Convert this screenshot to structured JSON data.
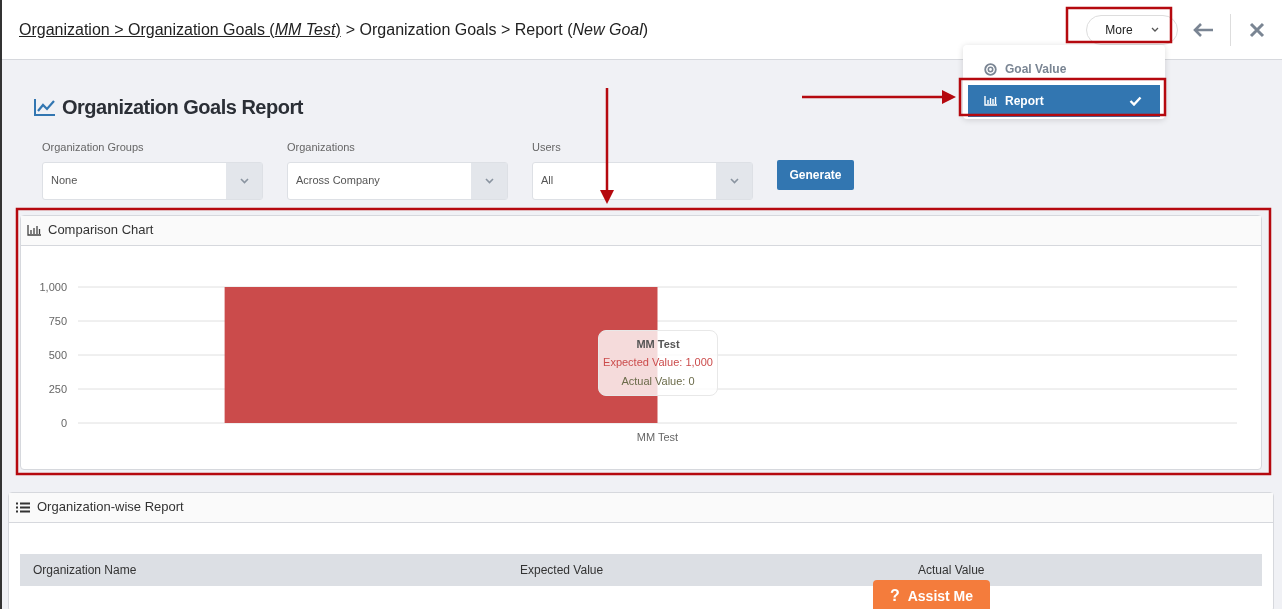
{
  "breadcrumb": [
    {
      "text": "Organization > Organization Goals (*MM Test*)",
      "link": true
    },
    {
      "text": "> Organization Goals > Report (*New Goal*)",
      "link": false
    }
  ],
  "more_button": {
    "label": "More"
  },
  "more_menu": [
    {
      "label": "Goal Value",
      "kind": "target",
      "selected": false
    },
    {
      "label": "Report",
      "kind": "chart",
      "selected": true
    }
  ],
  "page_title": "Organization Goals Report",
  "filters": [
    {
      "label": "Organization Groups",
      "value": "None"
    },
    {
      "label": "Organizations",
      "value": "Across Company"
    },
    {
      "label": "Users",
      "value": "All"
    }
  ],
  "generate_button": "Generate",
  "comparison_chart": {
    "title": "Comparison Chart",
    "chart_data": {
      "type": "bar",
      "categories": [
        "MM Test"
      ],
      "series": [
        {
          "color": "#cb4b4b",
          "values": [
            1000
          ]
        },
        {
          "color": "#6b6b4a",
          "values": [
            0
          ]
        }
      ],
      "grid": true,
      "ylim": [
        0,
        1000
      ],
      "yticks": [
        0,
        250,
        500,
        750,
        {
          "value": 1000,
          "label": "1,000"
        }
      ]
    },
    "tooltip": {
      "title": "MM Test",
      "lines": [
        {
          "text": "Expected Value: 1,000",
          "color": "#cb4b4b"
        },
        {
          "text": "Actual Value: 0",
          "color": "#6b6b4a"
        }
      ]
    }
  },
  "report": {
    "title": "Organization-wise Report",
    "columns": [
      "Organization Name",
      "Expected Value",
      "Actual Value"
    ]
  },
  "assist_button": {
    "icon_text": "?",
    "label": "Assist Me"
  }
}
